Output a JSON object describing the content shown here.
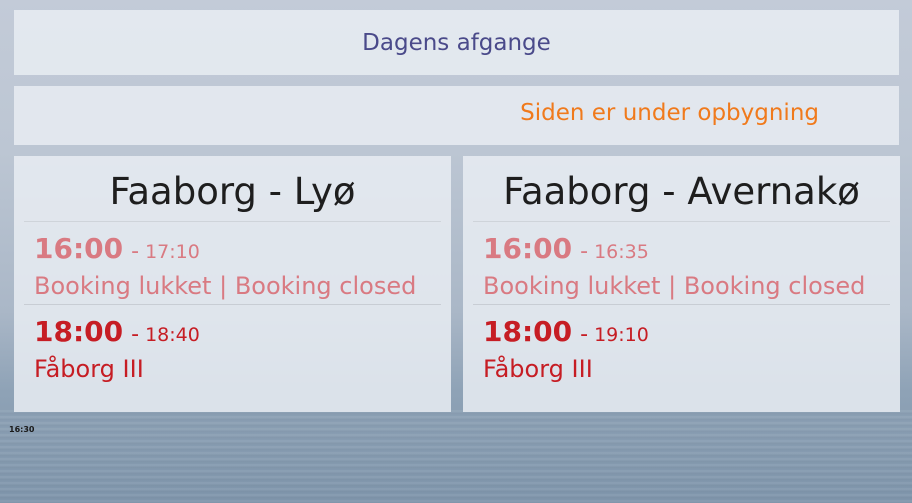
{
  "header": {
    "title": "Dagens afgange"
  },
  "notice": {
    "text": "Siden er under opbygning"
  },
  "routes": [
    {
      "title": "Faaborg - Lyø",
      "departures": [
        {
          "depart": "16:00",
          "separator": "-",
          "arrive": "17:10",
          "status": "Booking lukket | Booking closed"
        },
        {
          "depart": "18:00",
          "separator": "-",
          "arrive": "18:40",
          "status": "Fåborg III"
        }
      ]
    },
    {
      "title": "Faaborg - Avernakø",
      "departures": [
        {
          "depart": "16:00",
          "separator": "-",
          "arrive": "16:35",
          "status": "Booking lukket | Booking closed"
        },
        {
          "depart": "18:00",
          "separator": "-",
          "arrive": "19:10",
          "status": "Fåborg III"
        }
      ]
    }
  ],
  "footer": {
    "clock": "16:30"
  },
  "colors": {
    "header_text": "#4a4a8a",
    "notice_text": "#f07a1c",
    "closed_text": "#d97a82",
    "open_text": "#c61d24"
  }
}
